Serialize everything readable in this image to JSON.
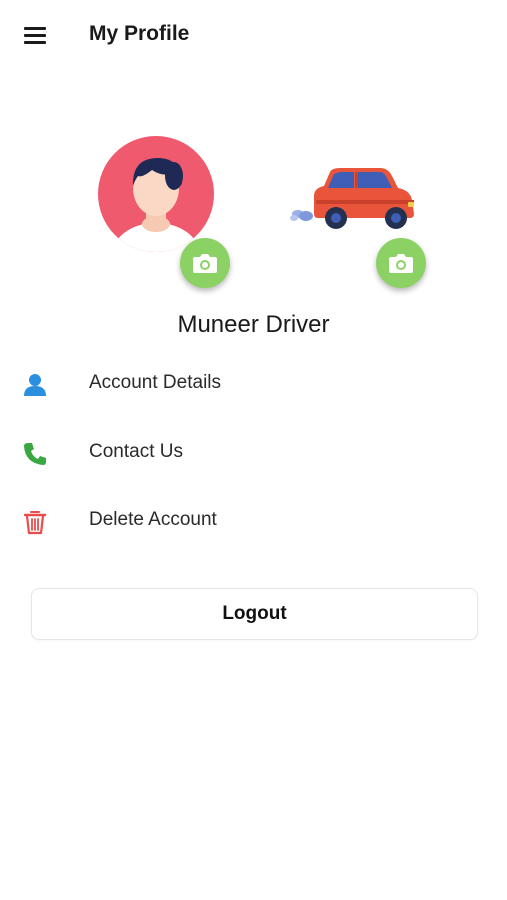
{
  "header": {
    "title": "My Profile",
    "menu_icon": "hamburger-menu-icon"
  },
  "profile": {
    "name": "Muneer Driver",
    "avatar_color": "#ef5a6f",
    "camera_button_color": "#8bd164"
  },
  "menu": {
    "items": [
      {
        "label": "Account Details",
        "icon": "person-icon",
        "icon_color": "#2b8fe0"
      },
      {
        "label": "Contact Us",
        "icon": "phone-icon",
        "icon_color": "#3aa840"
      },
      {
        "label": "Delete Account",
        "icon": "trash-icon",
        "icon_color": "#e84c4c"
      }
    ]
  },
  "logout": {
    "label": "Logout"
  }
}
